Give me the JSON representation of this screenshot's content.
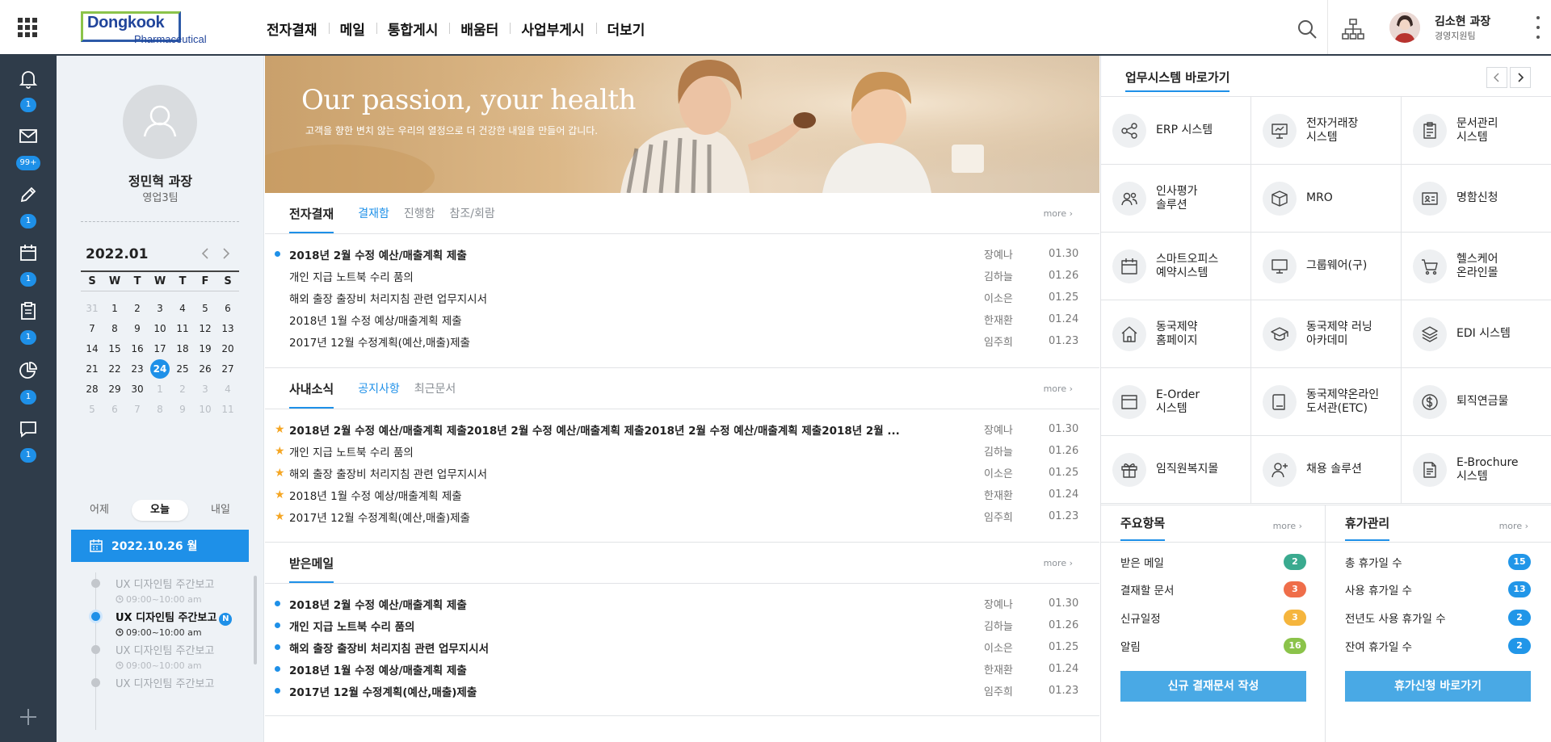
{
  "brand": {
    "name": "Dongkook",
    "sub": "Pharmaceutical"
  },
  "gnb": [
    "전자결재",
    "메일",
    "통합게시",
    "배움터",
    "사업부게시",
    "더보기"
  ],
  "top_user": {
    "name": "김소현 과장",
    "dept": "경영지원팀"
  },
  "rail": [
    {
      "icon": "bell-icon",
      "badge": "1"
    },
    {
      "icon": "mail-icon",
      "badge": "99+"
    },
    {
      "icon": "pen-icon",
      "badge": "1"
    },
    {
      "icon": "calendar-icon",
      "badge": "1"
    },
    {
      "icon": "clipboard-icon",
      "badge": "1"
    },
    {
      "icon": "pie-chart-icon",
      "badge": "1"
    },
    {
      "icon": "chat-icon",
      "badge": "1"
    }
  ],
  "profile": {
    "name": "정민혁 과장",
    "dept": "영업3팀"
  },
  "calendar": {
    "month": "2022.01",
    "dow": [
      "S",
      "W",
      "T",
      "W",
      "T",
      "F",
      "S"
    ],
    "weeks": [
      [
        "31",
        "1",
        "2",
        "3",
        "4",
        "5",
        "6"
      ],
      [
        "7",
        "8",
        "9",
        "10",
        "11",
        "12",
        "13"
      ],
      [
        "14",
        "15",
        "16",
        "17",
        "18",
        "19",
        "20"
      ],
      [
        "21",
        "22",
        "23",
        "24",
        "25",
        "26",
        "27"
      ],
      [
        "28",
        "29",
        "30",
        "1",
        "2",
        "3",
        "4"
      ],
      [
        "5",
        "6",
        "7",
        "8",
        "9",
        "10",
        "11"
      ]
    ],
    "today": "24"
  },
  "day_tabs": [
    "어제",
    "오늘",
    "내일"
  ],
  "date_bar": "2022.10.26 월",
  "schedule": [
    {
      "title": "UX 디자인팀 주간보고",
      "time": "09:00~10:00 am",
      "active": false
    },
    {
      "title": "UX 디자인팀 주간보고",
      "time": "09:00~10:00 am",
      "active": true,
      "badge": "N"
    },
    {
      "title": "UX 디자인팀 주간보고",
      "time": "09:00~10:00 am",
      "active": false
    },
    {
      "title": "UX 디자인팀 주간보고",
      "time": "",
      "active": false
    }
  ],
  "banner": {
    "title": "Our passion, your health",
    "sub": "고객을 향한 변치 않는 우리의 열정으로 더 건강한 내일을 만들어 갑니다."
  },
  "approval": {
    "title": "전자결재",
    "tabs": [
      "결재함",
      "진행함",
      "참조/회람"
    ],
    "more": "more",
    "rows": [
      {
        "title": "2018년 2월 수정 예산/매출계획 제출",
        "author": "장예나",
        "date": "01.30",
        "bold": true,
        "bullet": true
      },
      {
        "title": "개인 지급 노트북 수리 품의",
        "author": "김하늘",
        "date": "01.26",
        "bold": false,
        "bullet": false
      },
      {
        "title": "해외 출장 출장비 처리지침 관련 업무지시서",
        "author": "이소은",
        "date": "01.25",
        "bold": false,
        "bullet": false
      },
      {
        "title": "2018년 1월 수정 예상/매출계획 제출",
        "author": "한재환",
        "date": "01.24",
        "bold": false,
        "bullet": false
      },
      {
        "title": "2017년 12월 수정계획(예산,매출)제출",
        "author": "임주희",
        "date": "01.23",
        "bold": false,
        "bullet": false
      }
    ]
  },
  "news": {
    "title": "사내소식",
    "tabs": [
      "공지사항",
      "최근문서"
    ],
    "more": "more",
    "rows": [
      {
        "title": "2018년 2월 수정 예산/매출계획 제출2018년 2월 수정 예산/매출계획 제출2018년 2월 수정 예산/매출계획 제출2018년 2월 ...",
        "author": "장예나",
        "date": "01.30",
        "bold": true
      },
      {
        "title": "개인 지급 노트북 수리 품의",
        "author": "김하늘",
        "date": "01.26",
        "bold": false
      },
      {
        "title": "해외 출장 출장비 처리지침 관련 업무지시서",
        "author": "이소은",
        "date": "01.25",
        "bold": false
      },
      {
        "title": "2018년 1월 수정 예상/매출계획 제출",
        "author": "한재환",
        "date": "01.24",
        "bold": false
      },
      {
        "title": "2017년 12월 수정계획(예산,매출)제출",
        "author": "임주희",
        "date": "01.23",
        "bold": false
      }
    ]
  },
  "mail": {
    "title": "받은메일",
    "more": "more",
    "rows": [
      {
        "title": "2018년 2월 수정 예산/매출계획 제출",
        "author": "장예나",
        "date": "01.30"
      },
      {
        "title": "개인 지급 노트북 수리 품의",
        "author": "김하늘",
        "date": "01.26"
      },
      {
        "title": "해외 출장 출장비 처리지침 관련 업무지시서",
        "author": "이소은",
        "date": "01.25"
      },
      {
        "title": "2018년 1월 수정 예상/매출계획 제출",
        "author": "한재환",
        "date": "01.24"
      },
      {
        "title": "2017년 12월 수정계획(예산,매출)제출",
        "author": "임주희",
        "date": "01.23"
      }
    ]
  },
  "systems": {
    "title": "업무시스템 바로가기",
    "items": [
      {
        "label": "ERP 시스템",
        "icon": "share-icon"
      },
      {
        "label": "전자거래장\n시스템",
        "icon": "presentation-icon"
      },
      {
        "label": "문서관리\n시스템",
        "icon": "clipboard-list-icon"
      },
      {
        "label": "인사평가\n솔루션",
        "icon": "users-icon"
      },
      {
        "label": "MRO",
        "icon": "box-icon"
      },
      {
        "label": "명함신청",
        "icon": "id-card-icon"
      },
      {
        "label": "스마트오피스\n예약시스템",
        "icon": "calendar-icon"
      },
      {
        "label": "그룹웨어(구)",
        "icon": "monitor-icon"
      },
      {
        "label": "헬스케어\n온라인몰",
        "icon": "cart-icon"
      },
      {
        "label": "동국제약\n홈페이지",
        "icon": "home-icon"
      },
      {
        "label": "동국제약 러닝\n아카데미",
        "icon": "graduation-cap-icon"
      },
      {
        "label": "EDI 시스템",
        "icon": "layers-icon"
      },
      {
        "label": "E-Order\n시스템",
        "icon": "window-icon"
      },
      {
        "label": "동국제약온라인\n도서관(ETC)",
        "icon": "book-icon"
      },
      {
        "label": "퇴직연금물",
        "icon": "coin-icon"
      },
      {
        "label": "임직원복지몰",
        "icon": "gift-icon"
      },
      {
        "label": "채용 솔루션",
        "icon": "user-plus-icon"
      },
      {
        "label": "E-Brochure\n시스템",
        "icon": "brochure-icon"
      }
    ]
  },
  "key_items": {
    "title": "주요항목",
    "more": "more",
    "rows": [
      {
        "label": "받은 메일",
        "count": "2",
        "color": "#3aaa8f"
      },
      {
        "label": "결재할 문서",
        "count": "3",
        "color": "#ef6e4a"
      },
      {
        "label": "신규일정",
        "count": "3",
        "color": "#f5b53d"
      },
      {
        "label": "알림",
        "count": "16",
        "color": "#8bc34a"
      }
    ],
    "button": "신규 결재문서 작성"
  },
  "vacation": {
    "title": "휴가관리",
    "more": "more",
    "rows": [
      {
        "label": "총 휴가일 수",
        "count": "15"
      },
      {
        "label": "사용 휴가일 수",
        "count": "13"
      },
      {
        "label": "전년도 사용 휴가일 수",
        "count": "2"
      },
      {
        "label": "잔여 휴가일 수",
        "count": "2"
      }
    ],
    "color": "#2196e8",
    "button": "휴가신청 바로가기"
  }
}
